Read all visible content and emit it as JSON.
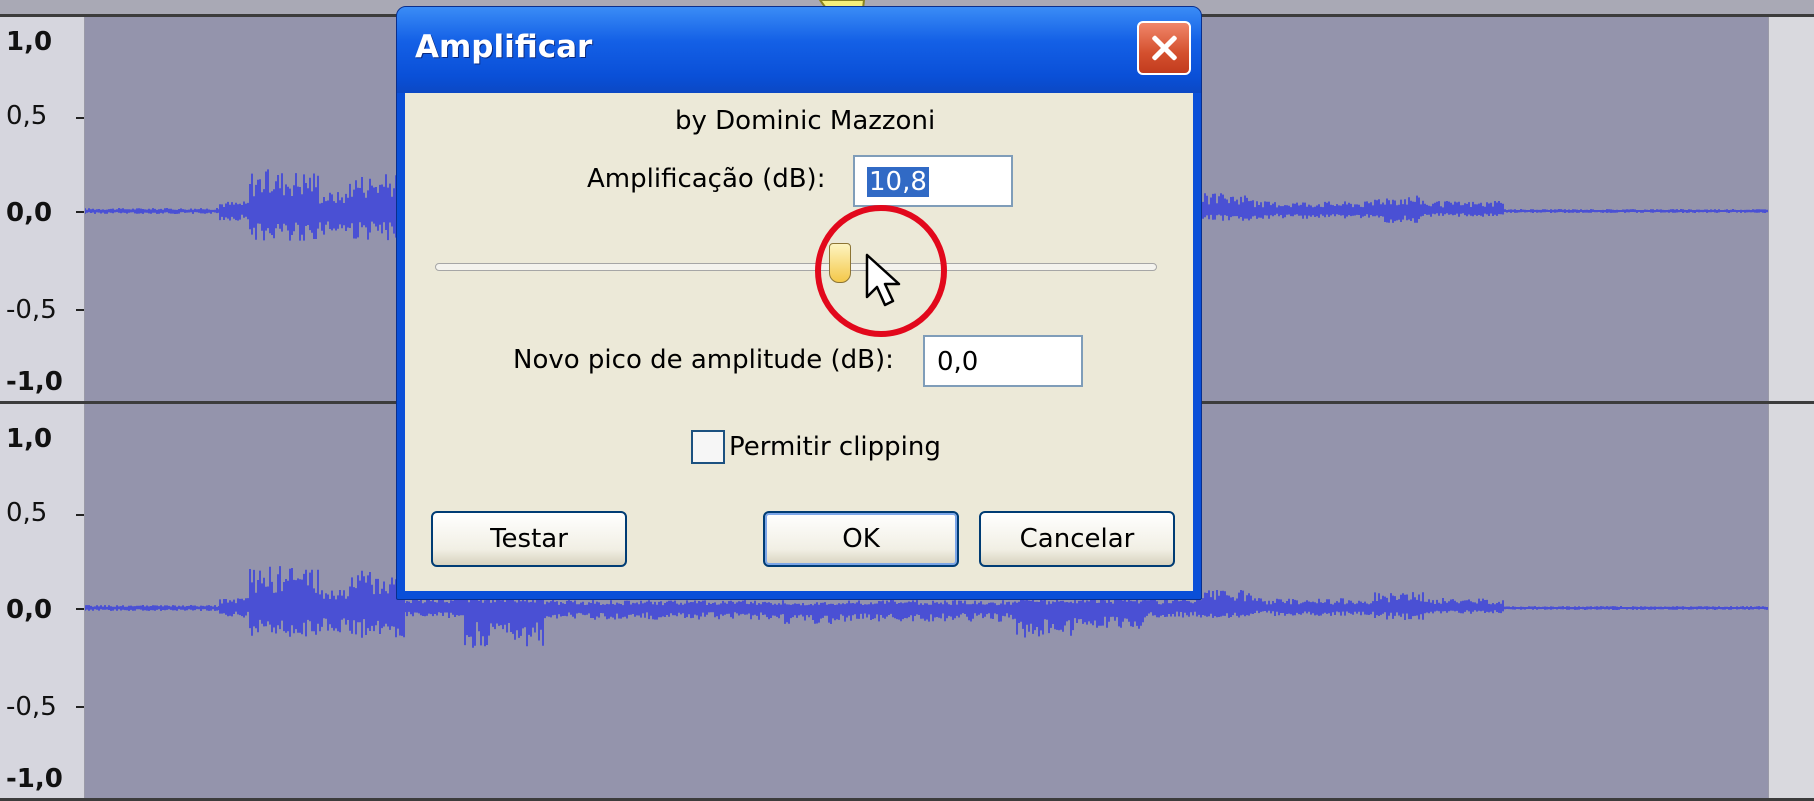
{
  "colors": {
    "waveform": "#4a50d4",
    "track_background": "#9494ac",
    "title_bar": "#0a50d8",
    "highlight_circle": "#e2081c",
    "selection": "#316ac5"
  },
  "tracks": [
    {
      "ruler": [
        "1,0",
        "0,5",
        "0,0",
        "-0,5",
        "-1,0"
      ]
    },
    {
      "ruler": [
        "1,0",
        "0,5",
        "0,0",
        "-0,5",
        "-1,0"
      ]
    }
  ],
  "dialog": {
    "title": "Amplificar",
    "close_icon": "close-icon",
    "author": "by Dominic Mazzoni",
    "amplification_label": "Amplificação (dB):",
    "amplification_value": "10,8",
    "slider_level_fraction": 0.59,
    "peak_label": "Novo pico de amplitude (dB):",
    "peak_value": "0,0",
    "clipping_label": "Permitir clipping",
    "clipping_checked": false,
    "buttons": {
      "preview": "Testar",
      "ok": "OK",
      "cancel": "Cancelar"
    }
  }
}
